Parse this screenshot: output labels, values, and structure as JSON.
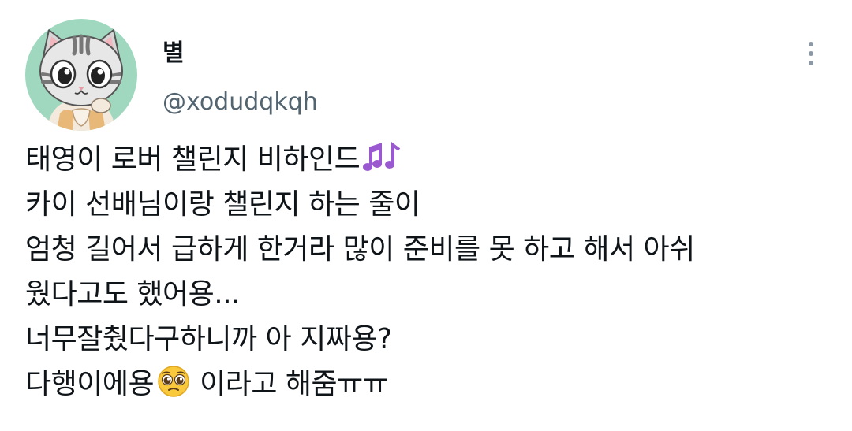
{
  "author": {
    "display_name": "별",
    "handle": "@xodudqkqh",
    "avatar_icon": "cat-cartoon-avatar"
  },
  "menu": {
    "icon": "more-vertical-icon"
  },
  "tweet": {
    "lines": [
      "태영이 로버 챌린지 비하인드",
      "카이 선배님이랑 챌린지 하는 줄이",
      "엄청 길어서 급하게 한거라 많이 준비를 못 하고 해서 아쉬",
      "웠다고도 했어용...",
      "너무잘췄다구하니까 아 지짜용?",
      "다행이에용",
      "이라고 해줌ㅠㅠ"
    ],
    "emojis": {
      "music": "musical-notes-icon",
      "pleading": "pleading-face-icon"
    }
  },
  "colors": {
    "text": "#0f1419",
    "secondary": "#536471",
    "avatar_bg": "#9fd8bf",
    "notes": "#9b59d0"
  }
}
